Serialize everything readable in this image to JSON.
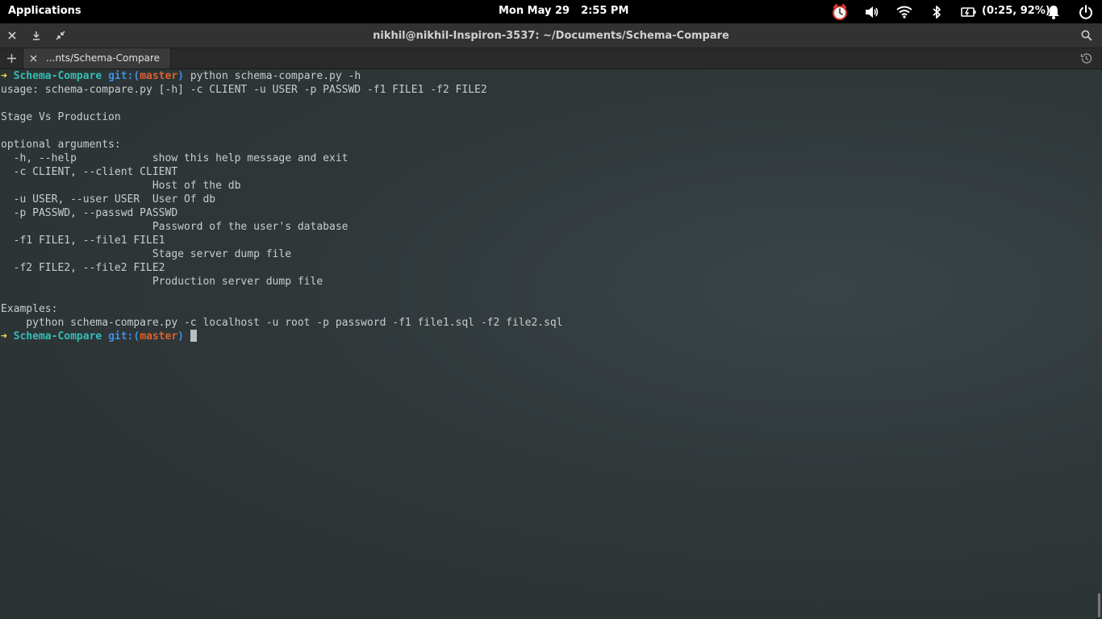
{
  "topbar": {
    "apps_label": "Applications",
    "date": "Mon May 29",
    "time": "2:55 PM",
    "battery": "(0:25, 92%)",
    "icons": [
      "alarm-clock-icon",
      "volume-icon",
      "wifi-icon",
      "bluetooth-icon",
      "battery-icon",
      "notification-bell-icon",
      "power-icon"
    ]
  },
  "window": {
    "title": "nikhil@nikhil-Inspiron-3537: ~/Documents/Schema-Compare"
  },
  "tabs": {
    "items": [
      {
        "label": "...nts/Schema-Compare"
      }
    ]
  },
  "terminal": {
    "prompt_arrow": "➜",
    "prompt_dir": "Schema-Compare",
    "prompt_git": "git:(",
    "prompt_branch": "master",
    "prompt_git_close": ")",
    "command": "python schema-compare.py -h",
    "output": [
      "usage: schema-compare.py [-h] -c CLIENT -u USER -p PASSWD -f1 FILE1 -f2 FILE2",
      "",
      "Stage Vs Production",
      "",
      "optional arguments:",
      "  -h, --help            show this help message and exit",
      "  -c CLIENT, --client CLIENT",
      "                        Host of the db",
      "  -u USER, --user USER  User Of db",
      "  -p PASSWD, --passwd PASSWD",
      "                        Password of the user's database",
      "  -f1 FILE1, --file1 FILE1",
      "                        Stage server dump file",
      "  -f2 FILE2, --file2 FILE2",
      "                        Production server dump file",
      "",
      "Examples:",
      "    python schema-compare.py -c localhost -u root -p password -f1 file1.sql -f2 file2.sql"
    ]
  }
}
